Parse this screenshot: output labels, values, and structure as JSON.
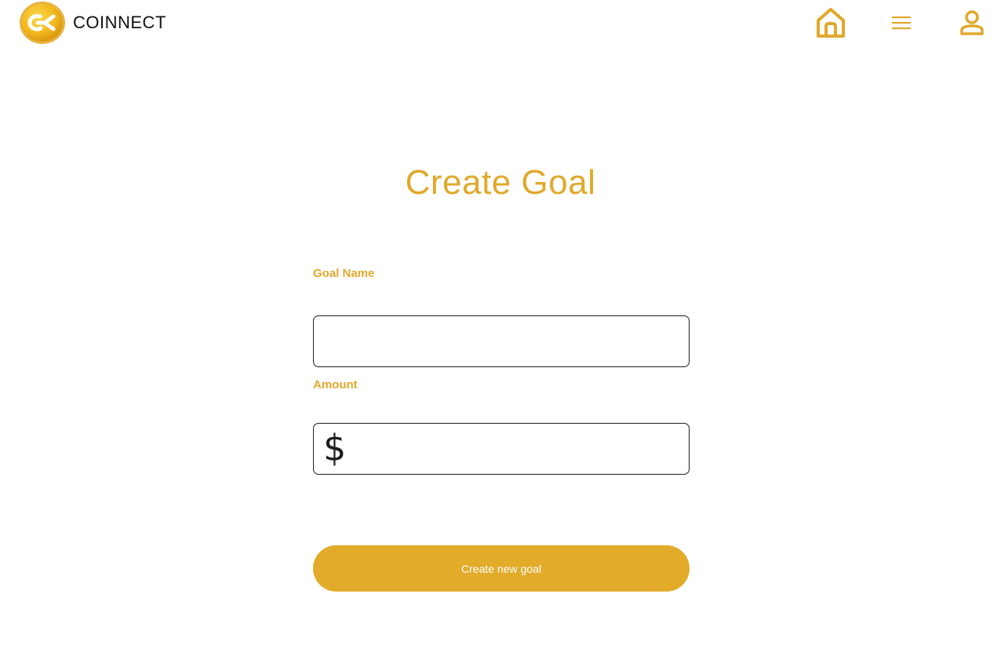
{
  "header": {
    "brand_name": "COINNECT",
    "logo_icon": "coinnect-coin-logo",
    "nav": [
      {
        "name": "home",
        "icon": "home-icon"
      },
      {
        "name": "menu",
        "icon": "hamburger-menu-icon"
      },
      {
        "name": "profile",
        "icon": "user-icon"
      }
    ]
  },
  "main": {
    "title": "Create Goal",
    "goal_name": {
      "label": "Goal Name",
      "value": "",
      "placeholder": ""
    },
    "amount": {
      "label": "Amount",
      "currency_symbol": "$",
      "value": "",
      "placeholder": ""
    },
    "submit_label": "Create new goal"
  },
  "colors": {
    "accent": "#e0a92b",
    "button": "#e2ab2a",
    "text_dark": "#111111",
    "border": "#1e1e1e"
  }
}
